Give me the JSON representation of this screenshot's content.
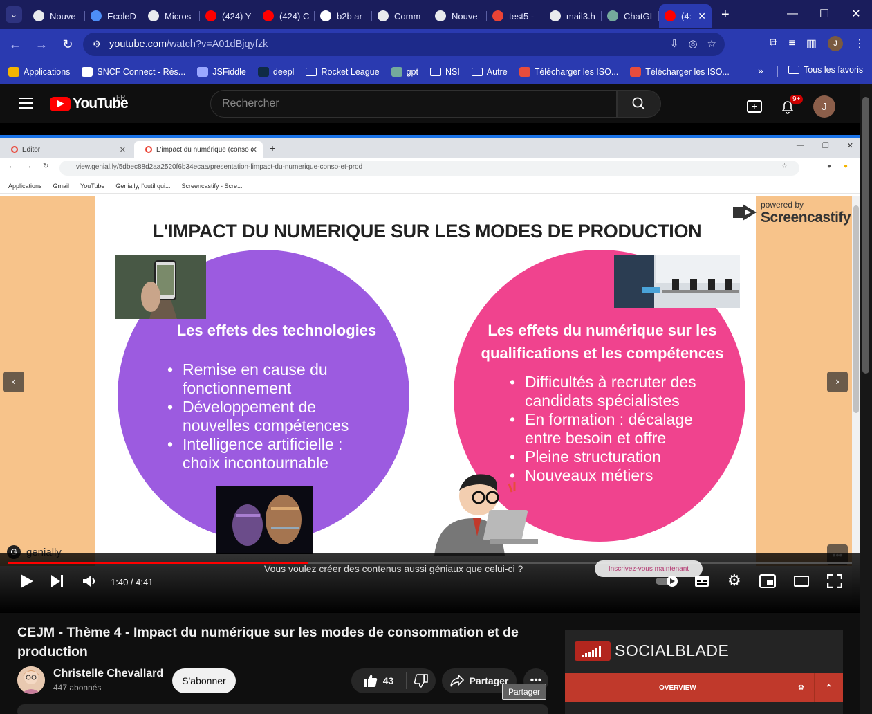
{
  "chrome": {
    "tabs": [
      {
        "title": "Nouve",
        "icon": "chrome-icon",
        "color": "#e8eaed"
      },
      {
        "title": "EcoleD",
        "icon": "ecole-icon",
        "color": "#4d8ef7"
      },
      {
        "title": "Micros",
        "icon": "globe-icon",
        "color": "#e8eaed"
      },
      {
        "title": "(424) Y",
        "icon": "youtube-icon",
        "color": "#ff0000"
      },
      {
        "title": "(424) C",
        "icon": "youtube-icon",
        "color": "#ff0000"
      },
      {
        "title": "b2b ar",
        "icon": "google-icon",
        "color": "#ffffff"
      },
      {
        "title": "Comm",
        "icon": "globe-icon",
        "color": "#e8eaed"
      },
      {
        "title": "Nouve",
        "icon": "chrome-icon",
        "color": "#e8eaed"
      },
      {
        "title": "test5 -",
        "icon": "gmail-icon",
        "color": "#ea4335"
      },
      {
        "title": "mail3.h",
        "icon": "globe-icon",
        "color": "#e8eaed"
      },
      {
        "title": "ChatGI",
        "icon": "chatgpt-icon",
        "color": "#74aa9c"
      },
      {
        "title": "(4:",
        "icon": "youtube-icon",
        "color": "#ff0000"
      }
    ],
    "url_main": "youtube.com",
    "url_rest": "/watch?v=A01dBjqyfzk",
    "avatar_letter": "J",
    "bookmarks": [
      {
        "label": "Applications",
        "icon": "apps-grid-icon"
      },
      {
        "label": "SNCF Connect - Rés...",
        "icon": "sncf-icon"
      },
      {
        "label": "JSFiddle",
        "icon": "jsfiddle-icon"
      },
      {
        "label": "deepl",
        "icon": "deepl-icon"
      },
      {
        "label": "Rocket League",
        "icon": "folder-icon"
      },
      {
        "label": "gpt",
        "icon": "chatgpt-icon"
      },
      {
        "label": "NSI",
        "icon": "folder-icon"
      },
      {
        "label": "Autre",
        "icon": "folder-icon"
      },
      {
        "label": "Télécharger les ISO...",
        "icon": "iso-icon"
      },
      {
        "label": "Télécharger les ISO...",
        "icon": "iso-icon"
      }
    ],
    "all_bookmarks": "Tous les favoris"
  },
  "youtube": {
    "logo_text": "YouTube",
    "region": "FR",
    "search_placeholder": "Rechercher",
    "notif_count": "9+",
    "avatar_letter": "J"
  },
  "inner_browser": {
    "tab1": "Editor",
    "tab2": "L'impact du numérique (conso et",
    "url": "view.genial.ly/5dbec88d2aa2520f6b34ecaa/presentation-limpact-du-numerique-conso-et-prod",
    "bookmarks": [
      "Applications",
      "Gmail",
      "YouTube",
      "Genially, l'outil qui...",
      "Screencastify - Scre..."
    ]
  },
  "slide": {
    "title": "L'IMPACT DU NUMERIQUE SUR LES MODES DE PRODUCTION",
    "left_heading": "Les effets des technologies",
    "left_items": [
      "Remise en cause du fonctionnement",
      "Développement de nouvelles compétences",
      "Intelligence artificielle : choix incontournable"
    ],
    "right_heading_1": "Les effets du numérique sur les",
    "right_heading_2": "qualifications et les compétences",
    "right_items": [
      "Difficultés à recruter des candidats spécialistes",
      "En formation : décalage entre besoin et offre",
      "Pleine structuration",
      "Nouveaux métiers"
    ],
    "powered_by": "powered by",
    "screencastify": "Screencastify",
    "genially": "genially"
  },
  "player": {
    "time": "1:40 / 4:41",
    "progress": 0.356,
    "promo_text": "Vous voulez créer des contenus aussi géniaux que celui-ci ?",
    "promo_button": "Inscrivez-vous maintenant"
  },
  "video": {
    "title": "CEJM - Thème 4 - Impact du numérique sur les modes de consommation et de production",
    "channel": "Christelle Chevallard",
    "subscribers": "447 abonnés",
    "subscribe": "S'abonner",
    "likes": "43",
    "share": "Partager",
    "tooltip": "Partager"
  },
  "socialblade": {
    "name": "SOCIALBLADE",
    "tab": "OVERVIEW"
  }
}
